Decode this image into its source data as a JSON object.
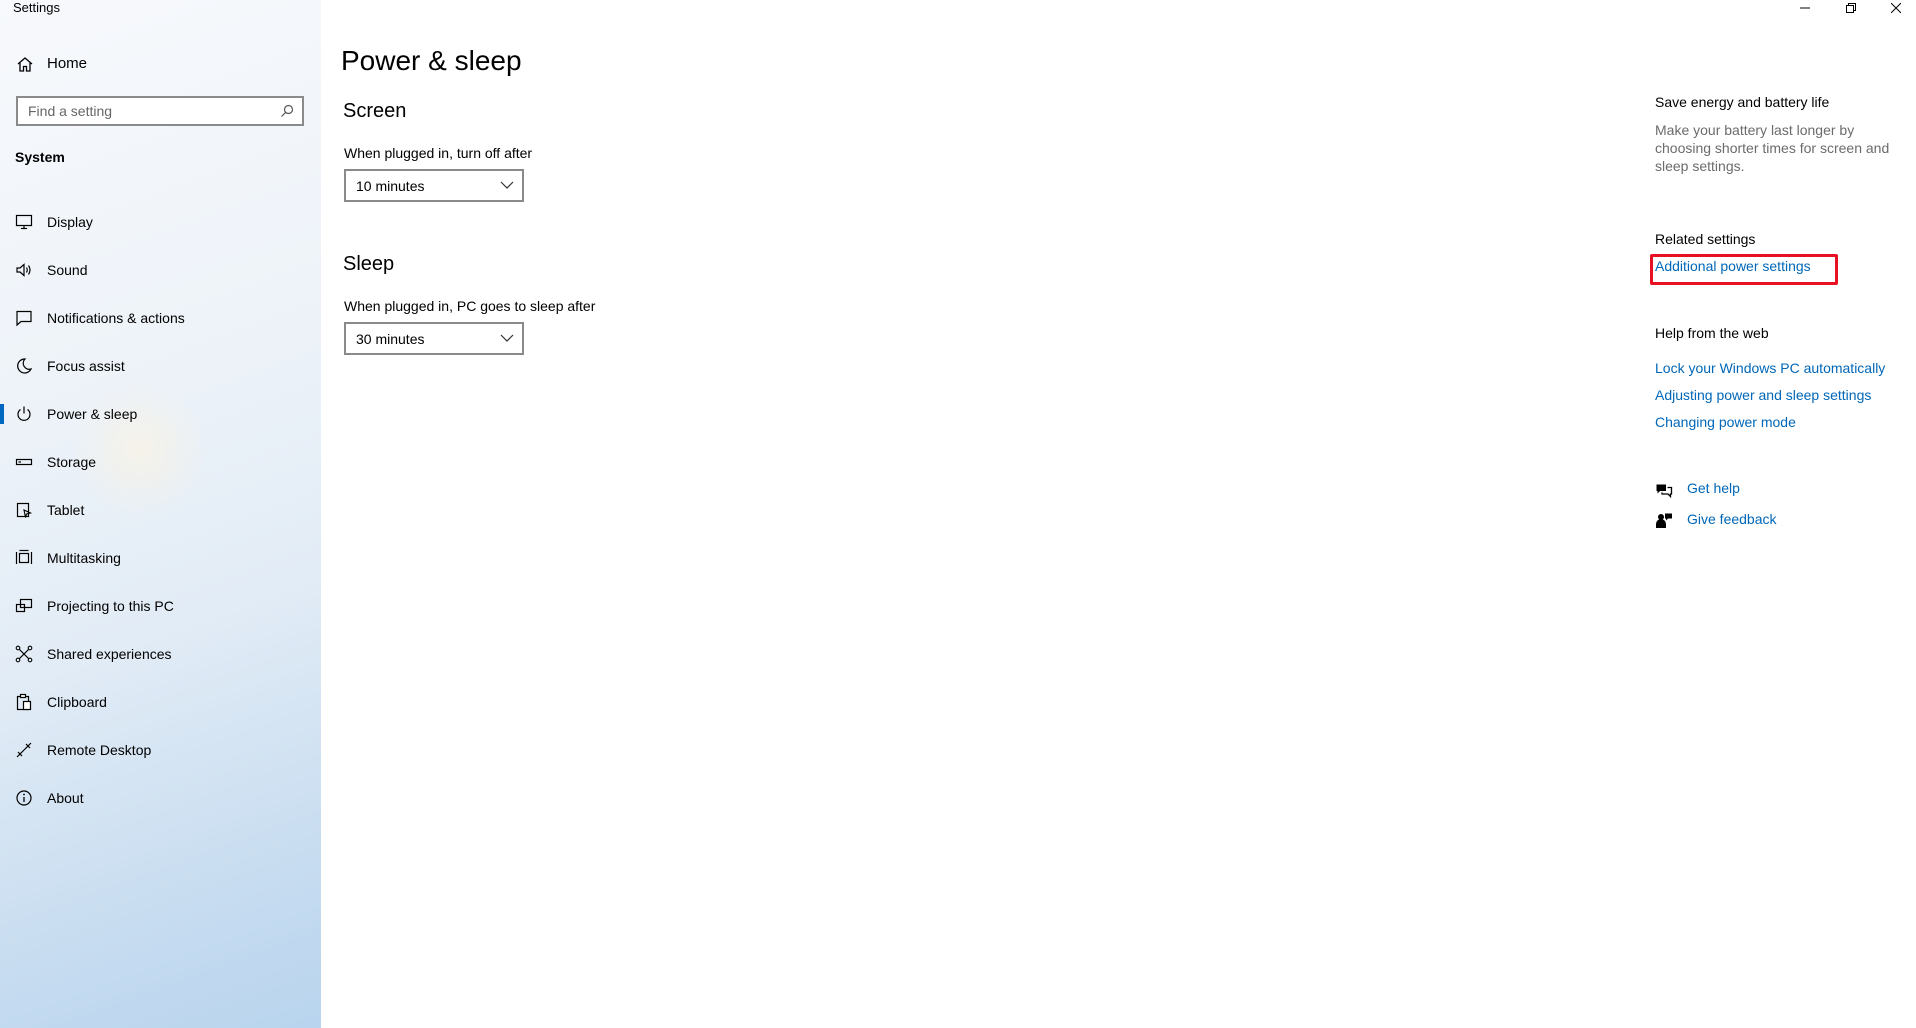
{
  "window": {
    "title": "Settings"
  },
  "sidebar": {
    "home_label": "Home",
    "search_placeholder": "Find a setting",
    "section_label": "System",
    "items": [
      {
        "label": "Display",
        "icon": "display-icon"
      },
      {
        "label": "Sound",
        "icon": "sound-icon"
      },
      {
        "label": "Notifications & actions",
        "icon": "notifications-icon"
      },
      {
        "label": "Focus assist",
        "icon": "moon-icon"
      },
      {
        "label": "Power & sleep",
        "icon": "power-icon",
        "selected": true
      },
      {
        "label": "Storage",
        "icon": "storage-icon"
      },
      {
        "label": "Tablet",
        "icon": "tablet-icon"
      },
      {
        "label": "Multitasking",
        "icon": "multitasking-icon"
      },
      {
        "label": "Projecting to this PC",
        "icon": "projecting-icon"
      },
      {
        "label": "Shared experiences",
        "icon": "shared-icon"
      },
      {
        "label": "Clipboard",
        "icon": "clipboard-icon"
      },
      {
        "label": "Remote Desktop",
        "icon": "remote-desktop-icon"
      },
      {
        "label": "About",
        "icon": "info-icon"
      }
    ]
  },
  "main": {
    "title": "Power & sleep",
    "screen": {
      "heading": "Screen",
      "label": "When plugged in, turn off after",
      "value": "10 minutes"
    },
    "sleep": {
      "heading": "Sleep",
      "label": "When plugged in, PC goes to sleep after",
      "value": "30 minutes"
    }
  },
  "aside": {
    "save_energy_title": "Save energy and battery life",
    "save_energy_desc": "Make your battery last longer by choosing shorter times for screen and sleep settings.",
    "related_title": "Related settings",
    "related_link": "Additional power settings",
    "help_title": "Help from the web",
    "help_links": [
      "Lock your Windows PC automatically",
      "Adjusting power and sleep settings",
      "Changing power mode"
    ],
    "get_help": "Get help",
    "give_feedback": "Give feedback"
  },
  "colors": {
    "accent": "#0067c0",
    "link": "#0067b8",
    "highlight": "#e81123"
  }
}
